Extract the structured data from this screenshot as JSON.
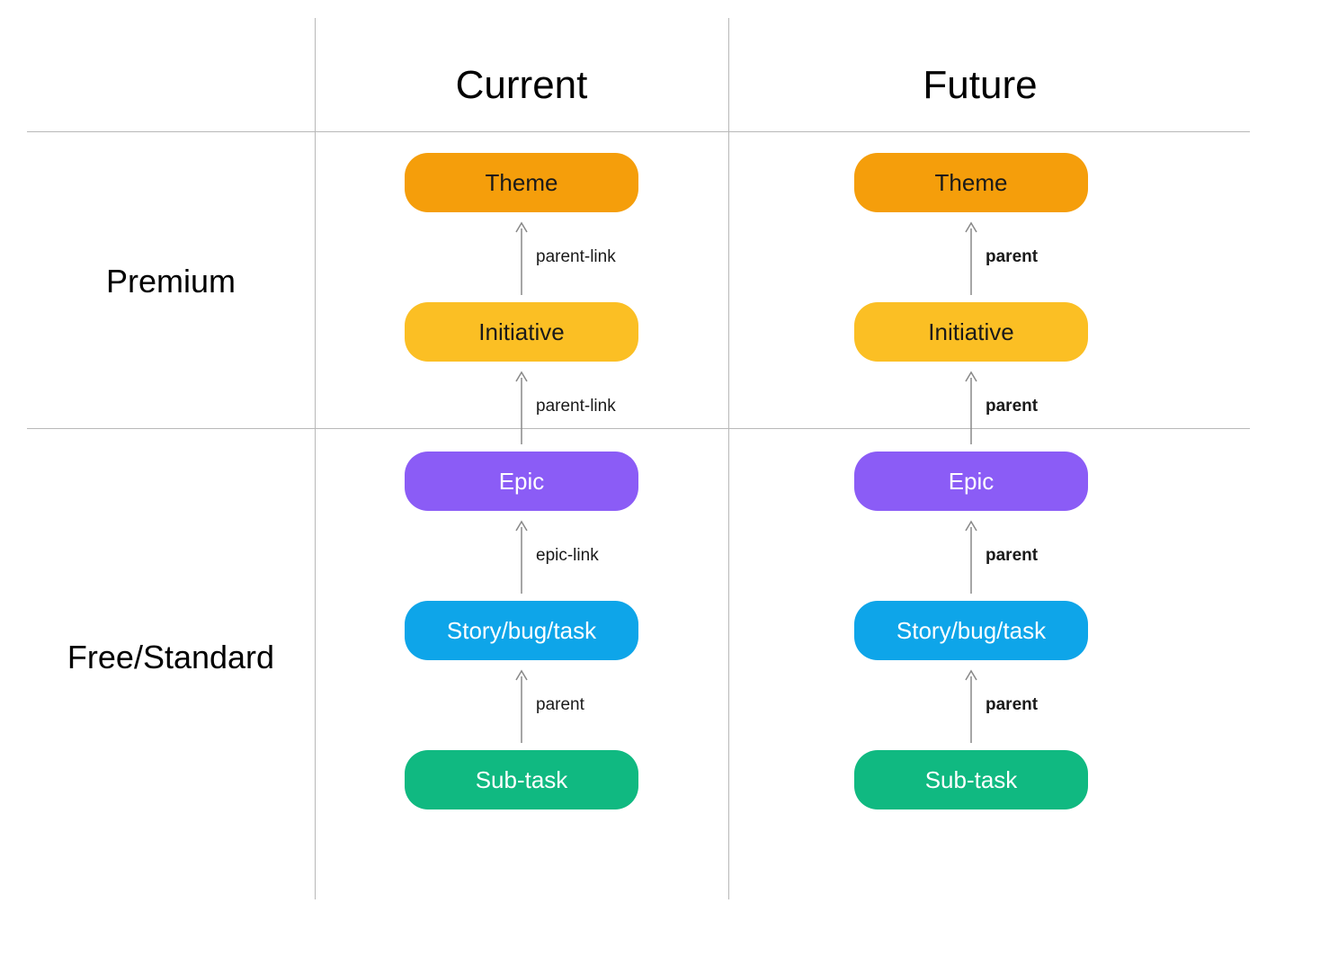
{
  "columns": {
    "current": "Current",
    "future": "Future"
  },
  "rows": {
    "premium": "Premium",
    "free": "Free/Standard"
  },
  "nodes": {
    "theme": "Theme",
    "initiative": "Initiative",
    "epic": "Epic",
    "story": "Story/bug/task",
    "subtask": "Sub-task"
  },
  "arrows": {
    "current": {
      "theme_initiative": "parent-link",
      "initiative_epic": "parent-link",
      "epic_story": "epic-link",
      "story_subtask": "parent"
    },
    "future": {
      "theme_initiative": "parent",
      "initiative_epic": "parent",
      "epic_story": "parent",
      "story_subtask": "parent"
    }
  },
  "colors": {
    "theme": "#f59e0b",
    "initiative": "#fbbf24",
    "epic": "#8b5cf6",
    "story": "#0ea5e9",
    "subtask": "#10b981",
    "line": "#b8b8b8",
    "arrow": "#888888"
  }
}
